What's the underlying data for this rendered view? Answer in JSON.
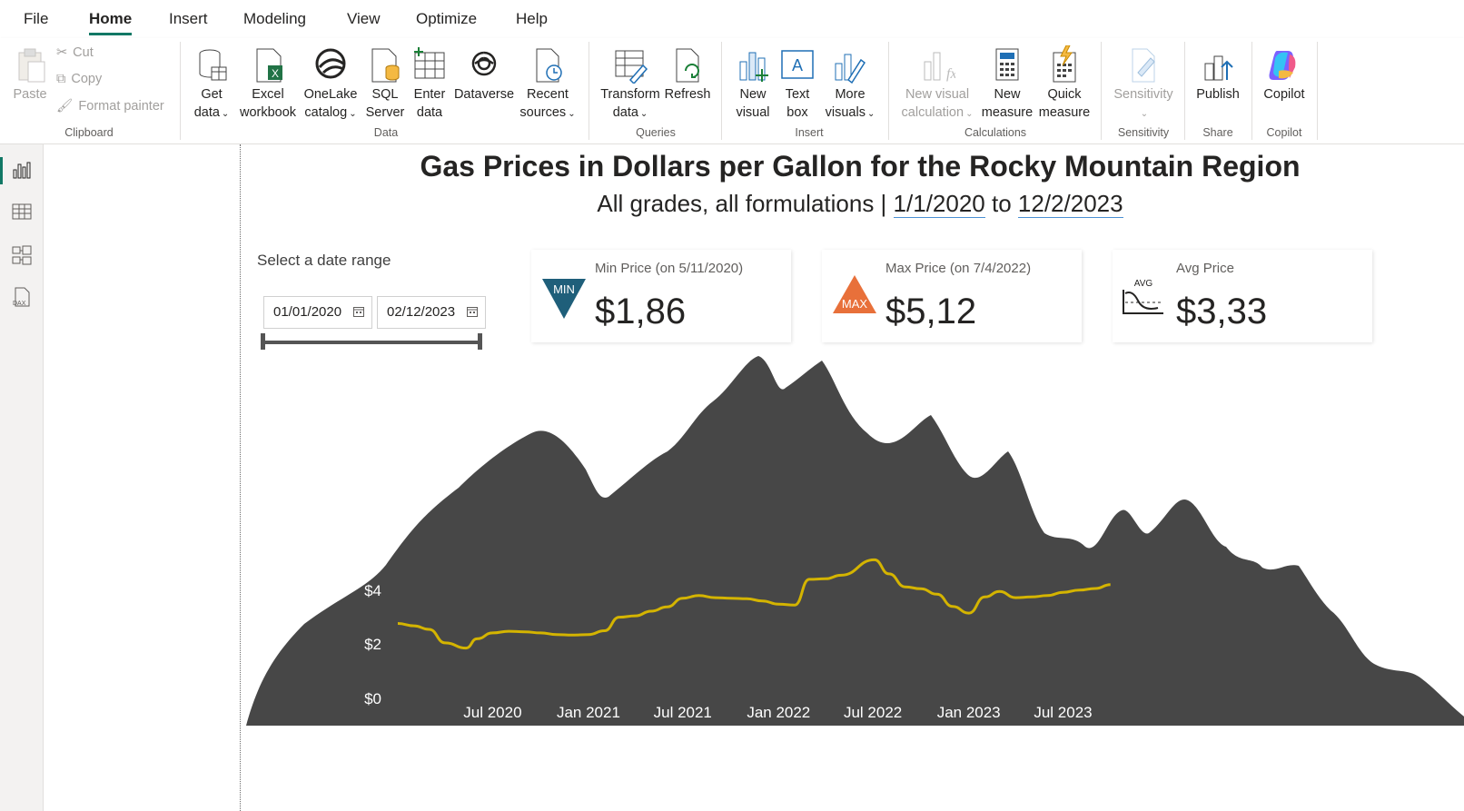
{
  "menu": {
    "tabs": [
      "File",
      "Home",
      "Insert",
      "Modeling",
      "View",
      "Optimize",
      "Help"
    ],
    "active": "Home"
  },
  "ribbon": {
    "clipboard": {
      "paste": "Paste",
      "cut": "Cut",
      "copy": "Copy",
      "format_painter": "Format painter",
      "group": "Clipboard"
    },
    "data": {
      "get_data": [
        "Get",
        "data"
      ],
      "excel": [
        "Excel",
        "workbook"
      ],
      "onelake": [
        "OneLake",
        "catalog"
      ],
      "sql": [
        "SQL",
        "Server"
      ],
      "enter": [
        "Enter",
        "data"
      ],
      "dataverse": "Dataverse",
      "recent": [
        "Recent",
        "sources"
      ],
      "group": "Data"
    },
    "queries": {
      "transform": [
        "Transform",
        "data"
      ],
      "refresh": "Refresh",
      "group": "Queries"
    },
    "insert": {
      "new_visual": [
        "New",
        "visual"
      ],
      "text_box": [
        "Text",
        "box"
      ],
      "more_visuals": [
        "More",
        "visuals"
      ],
      "group": "Insert"
    },
    "calculations": {
      "new_visual_calc": [
        "New visual",
        "calculation"
      ],
      "new_measure": [
        "New",
        "measure"
      ],
      "quick_measure": [
        "Quick",
        "measure"
      ],
      "group": "Calculations"
    },
    "sensitivity": {
      "label": "Sensitivity",
      "group": "Sensitivity"
    },
    "share": {
      "publish": "Publish",
      "group": "Share"
    },
    "copilot": {
      "label": "Copilot",
      "group": "Copilot"
    }
  },
  "report": {
    "title": "Gas Prices in Dollars per Gallon for the Rocky Mountain Region",
    "subtitle_prefix": "All grades, all formulations | ",
    "subtitle_start": "1/1/2020",
    "subtitle_mid": " to ",
    "subtitle_end": "12/2/2023",
    "slicer": {
      "label": "Select a date range",
      "start": "01/01/2020",
      "end": "02/12/2023"
    },
    "kpis": {
      "min": {
        "label": "Min Price (on 5/11/2020)",
        "value": "$1,86",
        "badge": "MIN",
        "color": "#1f5f7a"
      },
      "max": {
        "label": "Max Price (on 7/4/2022)",
        "value": "$5,12",
        "badge": "MAX",
        "color": "#e8703a"
      },
      "avg": {
        "label": "Avg Price",
        "value": "$3,33",
        "badge": "AVG"
      }
    }
  },
  "chart_data": {
    "type": "area",
    "x_ticks": [
      "Jul 2020",
      "Jan 2021",
      "Jul 2021",
      "Jan 2022",
      "Jul 2022",
      "Jan 2023",
      "Jul 2023"
    ],
    "y_ticks": [
      "$4",
      "$2",
      "$0"
    ],
    "ylim": [
      0,
      4
    ],
    "line_color": "#d4b400",
    "area_color": "#474747",
    "series": [
      {
        "values": [
          [
            "2020-01-01",
            2.77
          ],
          [
            "2020-02-01",
            2.68
          ],
          [
            "2020-03-01",
            2.55
          ],
          [
            "2020-04-01",
            2.05
          ],
          [
            "2020-05-11",
            1.86
          ],
          [
            "2020-06-01",
            2.2
          ],
          [
            "2020-07-01",
            2.42
          ],
          [
            "2020-08-01",
            2.48
          ],
          [
            "2020-09-01",
            2.46
          ],
          [
            "2020-10-01",
            2.42
          ],
          [
            "2020-11-01",
            2.36
          ],
          [
            "2020-12-01",
            2.34
          ],
          [
            "2021-01-01",
            2.36
          ],
          [
            "2021-02-01",
            2.5
          ],
          [
            "2021-03-01",
            3.0
          ],
          [
            "2021-04-01",
            3.05
          ],
          [
            "2021-05-01",
            3.22
          ],
          [
            "2021-06-01",
            3.38
          ],
          [
            "2021-07-01",
            3.7
          ],
          [
            "2021-08-01",
            3.8
          ],
          [
            "2021-09-01",
            3.72
          ],
          [
            "2021-10-01",
            3.7
          ],
          [
            "2021-11-01",
            3.68
          ],
          [
            "2021-12-01",
            3.6
          ],
          [
            "2022-01-01",
            3.48
          ],
          [
            "2022-02-01",
            3.45
          ],
          [
            "2022-03-01",
            4.4
          ],
          [
            "2022-04-01",
            4.42
          ],
          [
            "2022-05-01",
            4.55
          ],
          [
            "2022-07-04",
            5.12
          ],
          [
            "2022-08-01",
            4.6
          ],
          [
            "2022-09-01",
            4.12
          ],
          [
            "2022-10-01",
            4.05
          ],
          [
            "2022-11-01",
            3.85
          ],
          [
            "2022-12-01",
            3.4
          ],
          [
            "2023-01-01",
            3.15
          ],
          [
            "2023-02-01",
            3.75
          ],
          [
            "2023-03-01",
            3.95
          ],
          [
            "2023-04-01",
            3.72
          ],
          [
            "2023-05-01",
            3.75
          ],
          [
            "2023-06-01",
            3.8
          ],
          [
            "2023-07-01",
            3.92
          ],
          [
            "2023-08-01",
            4.0
          ],
          [
            "2023-09-01",
            4.06
          ],
          [
            "2023-09-30",
            4.2
          ]
        ]
      }
    ]
  }
}
